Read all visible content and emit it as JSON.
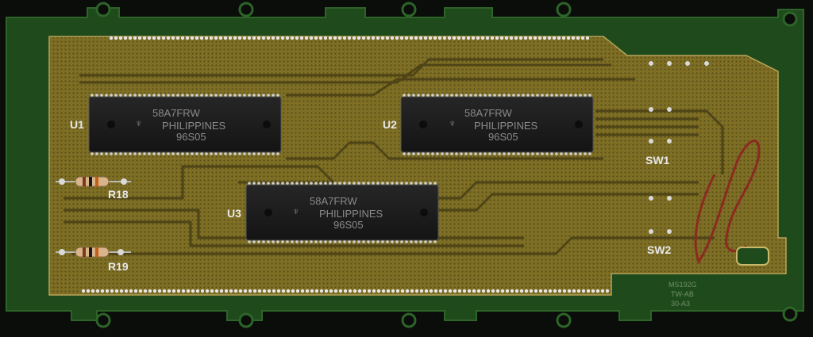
{
  "board": {
    "colors": {
      "background": "#0b0d0b",
      "mask_green": "#1f4a1c",
      "gold_plane": "#8a7a2a",
      "trace": "#4e4416",
      "chip_body": "#1b1b1b",
      "marker": "#8a2a20"
    },
    "chips": [
      {
        "ref": "U1",
        "line1": "58A7FRW",
        "line2": "PHILIPPINES",
        "line3": "96S05"
      },
      {
        "ref": "U2",
        "line1": "58A7FRW",
        "line2": "PHILIPPINES",
        "line3": "96S05"
      },
      {
        "ref": "U3",
        "line1": "58A7FRW",
        "line2": "PHILIPPINES",
        "line3": "96S05"
      }
    ],
    "resistors": [
      {
        "ref": "R18"
      },
      {
        "ref": "R19"
      }
    ],
    "switches": [
      {
        "ref": "SW1"
      },
      {
        "ref": "SW2"
      }
    ],
    "marking": {
      "line1": "MS192G",
      "line2": "TW-AB",
      "line3": "30-A3"
    }
  }
}
